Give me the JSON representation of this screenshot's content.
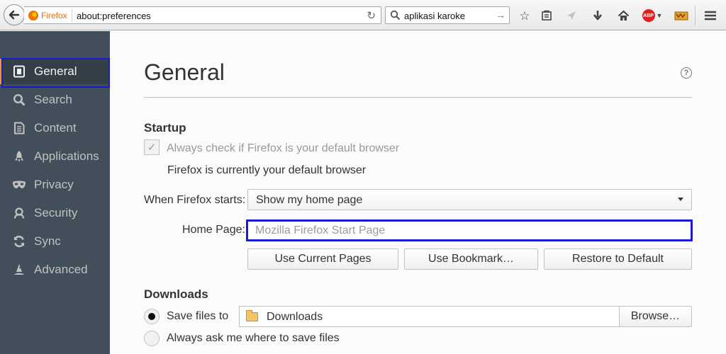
{
  "toolbar": {
    "identity_label": "Firefox",
    "url": "about:preferences",
    "search_query": "aplikasi karoke",
    "icons": [
      "back-arrow-icon",
      "firefox-logo-icon",
      "reload-icon",
      "search-icon",
      "go-arrow-icon",
      "star-icon",
      "reading-list-icon",
      "send-icon",
      "download-icon",
      "home-icon",
      "adblock-plus-icon",
      "extension-icon",
      "hamburger-menu-icon"
    ],
    "abp_label": "ABP"
  },
  "sidebar": {
    "items": [
      {
        "label": "General",
        "icon": "general-icon",
        "selected": true
      },
      {
        "label": "Search",
        "icon": "search-icon"
      },
      {
        "label": "Content",
        "icon": "content-icon"
      },
      {
        "label": "Applications",
        "icon": "applications-icon"
      },
      {
        "label": "Privacy",
        "icon": "privacy-mask-icon"
      },
      {
        "label": "Security",
        "icon": "security-icon"
      },
      {
        "label": "Sync",
        "icon": "sync-icon"
      },
      {
        "label": "Advanced",
        "icon": "advanced-wizard-icon"
      }
    ]
  },
  "main": {
    "title": "General",
    "help_glyph": "?",
    "startup": {
      "heading": "Startup",
      "default_check_label": "Always check if Firefox is your default browser",
      "default_status": "Firefox is currently your default browser",
      "when_starts_label": "When Firefox starts:",
      "when_starts_value": "Show my home page",
      "homepage_label": "Home Page:",
      "homepage_placeholder": "Mozilla Firefox Start Page",
      "buttons": {
        "use_current": "Use Current Pages",
        "use_bookmark": "Use Bookmark…",
        "restore_default": "Restore to Default"
      }
    },
    "downloads": {
      "heading": "Downloads",
      "save_files_label": "Save files to",
      "folder": "Downloads",
      "browse": "Browse…",
      "always_ask_label": "Always ask me where to save files"
    }
  }
}
